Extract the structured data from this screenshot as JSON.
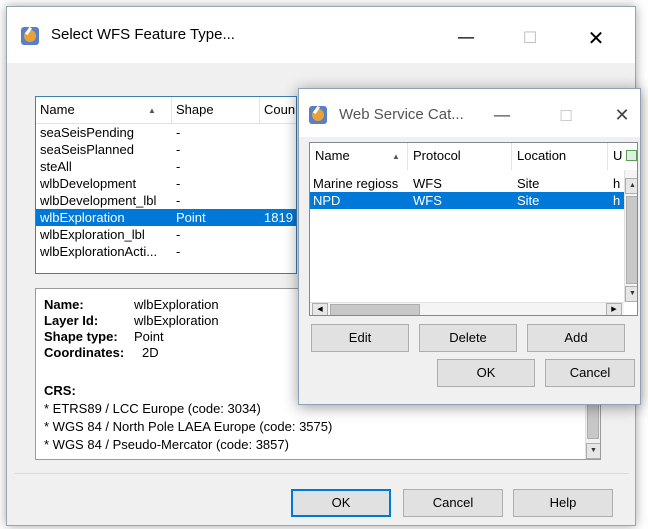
{
  "main": {
    "title": "Select WFS Feature Type...",
    "controls": {
      "minimize": "—",
      "maximize": "☐",
      "close": "✕"
    },
    "feature_list": {
      "columns": [
        "Name",
        "Shape",
        "Coun"
      ],
      "rows": [
        {
          "name": "seaSeisPending",
          "shape": "-",
          "count": ""
        },
        {
          "name": "seaSeisPlanned",
          "shape": "-",
          "count": ""
        },
        {
          "name": "steAll",
          "shape": "-",
          "count": ""
        },
        {
          "name": "wlbDevelopment",
          "shape": "-",
          "count": ""
        },
        {
          "name": "wlbDevelopment_lbl",
          "shape": "-",
          "count": ""
        },
        {
          "name": "wlbExploration",
          "shape": "Point",
          "count": "1819",
          "selected": true
        },
        {
          "name": "wlbExploration_lbl",
          "shape": "-",
          "count": ""
        },
        {
          "name": "wlbExplorationActi...",
          "shape": "-",
          "count": ""
        }
      ]
    },
    "details": {
      "name_label": "Name:",
      "name_value": "wlbExploration",
      "layer_label": "Layer Id:",
      "layer_value": "wlbExploration",
      "shape_label": "Shape type:",
      "shape_value": "Point",
      "coord_label": "Coordinates:",
      "coord_value": "2D",
      "crs_label": "CRS:",
      "crs": [
        "* ETRS89 / LCC Europe (code: 3034)",
        "* WGS 84 / North Pole LAEA Europe (code: 3575)",
        "* WGS 84 / Pseudo-Mercator (code: 3857)"
      ]
    },
    "buttons": {
      "ok": "OK",
      "cancel": "Cancel",
      "help": "Help"
    }
  },
  "catalog": {
    "title": "Web Service Cat...",
    "controls": {
      "minimize": "—",
      "maximize": "☐",
      "close": "✕"
    },
    "columns": [
      "Name",
      "Protocol",
      "Location",
      "U"
    ],
    "rows": [
      {
        "name": "Marine regioss",
        "protocol": "WFS",
        "location": "Site",
        "u": "h"
      },
      {
        "name": "NPD",
        "protocol": "WFS",
        "location": "Site",
        "u": "h",
        "selected": true
      }
    ],
    "buttons": {
      "edit": "Edit",
      "delete": "Delete",
      "add": "Add",
      "ok": "OK",
      "cancel": "Cancel"
    }
  }
}
